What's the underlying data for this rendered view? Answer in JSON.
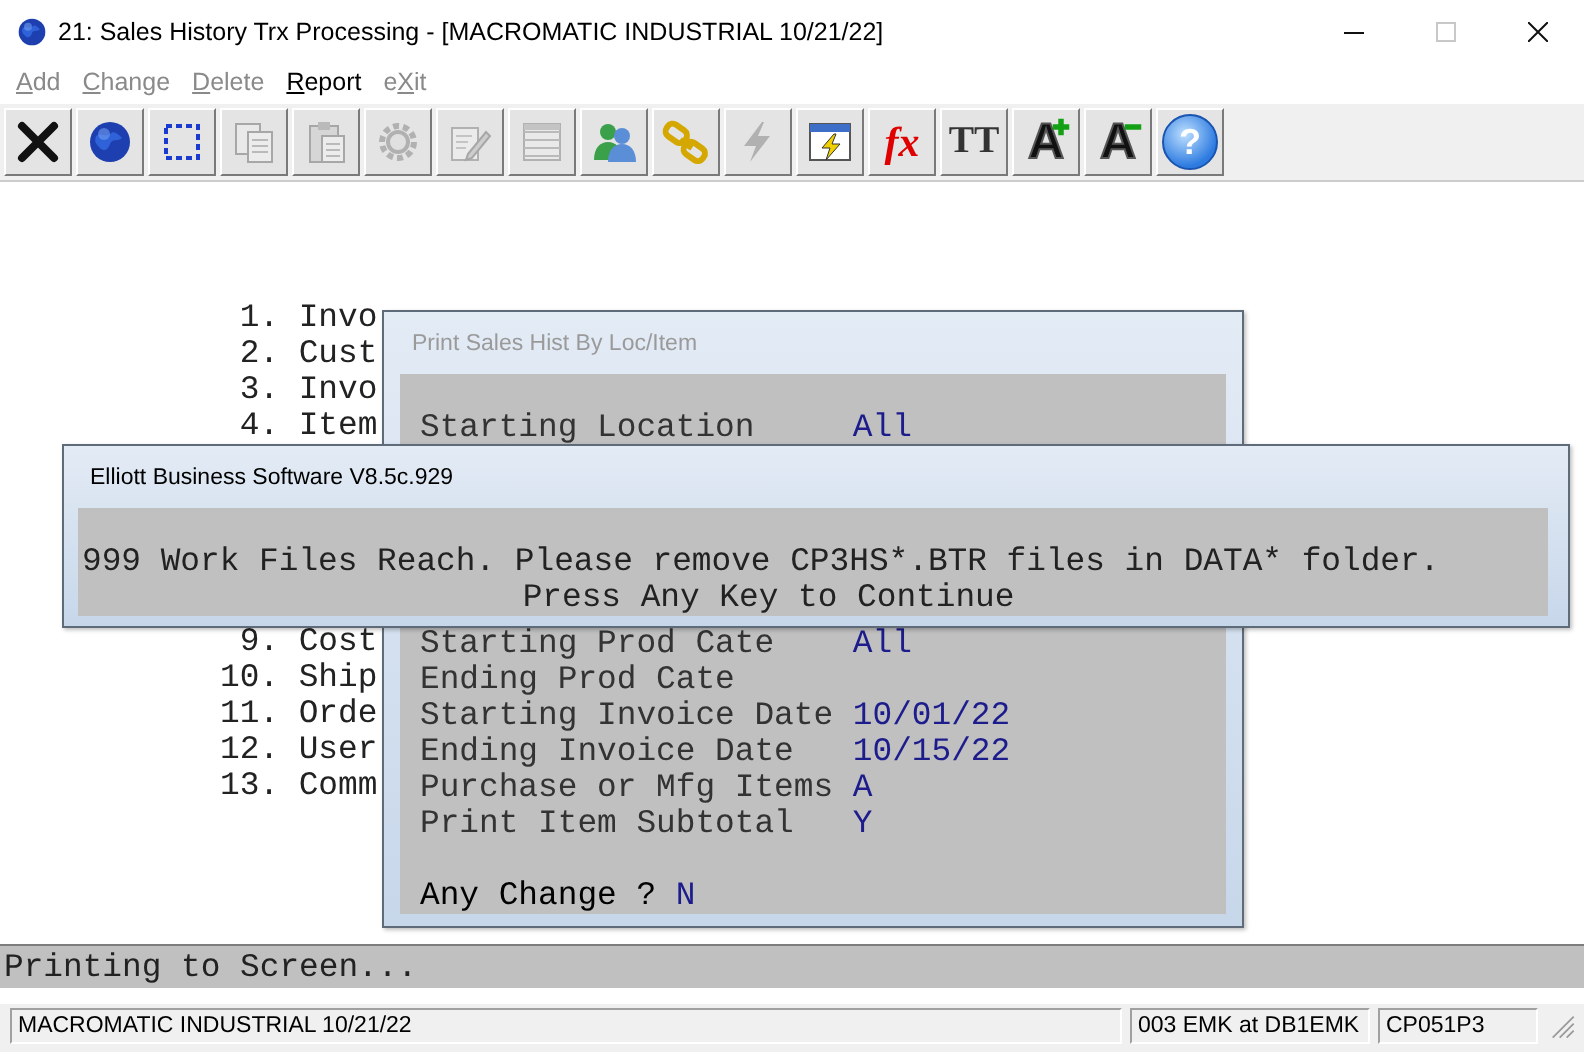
{
  "window": {
    "title": "21: Sales History Trx Processing - [MACROMATIC INDUSTRIAL 10/21/22]",
    "controls": [
      {
        "kind": "minimize",
        "disabled": false
      },
      {
        "kind": "maximize",
        "disabled": true
      },
      {
        "kind": "close",
        "disabled": false
      }
    ]
  },
  "menu": [
    {
      "key": "A",
      "after": "dd",
      "disabled": true
    },
    {
      "key": "C",
      "after": "hange",
      "disabled": true
    },
    {
      "key": "D",
      "after": "elete",
      "disabled": true
    },
    {
      "key": "R",
      "after": "eport",
      "disabled": false
    },
    {
      "before": "e",
      "key": "X",
      "after": "it",
      "disabled": true
    }
  ],
  "toolbar": [
    {
      "disabled": false
    },
    {
      "disabled": false
    },
    {
      "disabled": false
    },
    {
      "disabled": true
    },
    {
      "disabled": true
    },
    {
      "disabled": true
    },
    {
      "disabled": true
    },
    {
      "disabled": true
    },
    {
      "disabled": false
    },
    {
      "disabled": false
    },
    {
      "disabled": true
    },
    {
      "disabled": false
    },
    {
      "label": "fx",
      "disabled": false
    },
    {
      "label": "TT",
      "disabled": false
    },
    {
      "label": "A",
      "disabled": false
    },
    {
      "label": "A",
      "disabled": false
    },
    {
      "label": "?",
      "disabled": false
    }
  ],
  "menu_list": [
    {
      "number": "1.",
      "label": "Invo"
    },
    {
      "number": "2.",
      "label": "Cust"
    },
    {
      "number": "3.",
      "label": "Invo"
    },
    {
      "number": "4.",
      "label": "Item"
    },
    {
      "number": "9.",
      "label": "Cost"
    },
    {
      "number": "10.",
      "label": "Ship"
    },
    {
      "number": "11.",
      "label": "Orde"
    },
    {
      "number": "12.",
      "label": "User"
    },
    {
      "number": "13.",
      "label": "Comm"
    }
  ],
  "print_dialog": {
    "title": "Print Sales Hist By Loc/Item",
    "active": false,
    "fields": [
      {
        "label": "Starting Location",
        "value": "All"
      },
      {
        "label": "Starting Prod Cate",
        "value": "All"
      },
      {
        "label": "Ending Prod Cate"
      },
      {
        "label": "Starting Invoice Date",
        "value": "10/01/22"
      },
      {
        "label": "Ending Invoice Date",
        "value": "10/15/22"
      },
      {
        "label": "Purchase or Mfg Items",
        "value": "A"
      },
      {
        "label": "Print Item Subtotal",
        "value": "Y"
      }
    ],
    "prompt": {
      "label": "Any Change ?",
      "value": "N"
    }
  },
  "message_dialog": {
    "title": "Elliott Business Software V8.5c.929",
    "active": true,
    "lines": [
      "999 Work Files Reach. Please remove CP3HS*.BTR files in DATA* folder.",
      "Press Any Key to Continue"
    ]
  },
  "status_line": "Printing to Screen...",
  "status_bar": [
    "MACROMATIC INDUSTRIAL 10/21/22",
    "003 EMK at DB1EMK",
    "CP051P3"
  ]
}
